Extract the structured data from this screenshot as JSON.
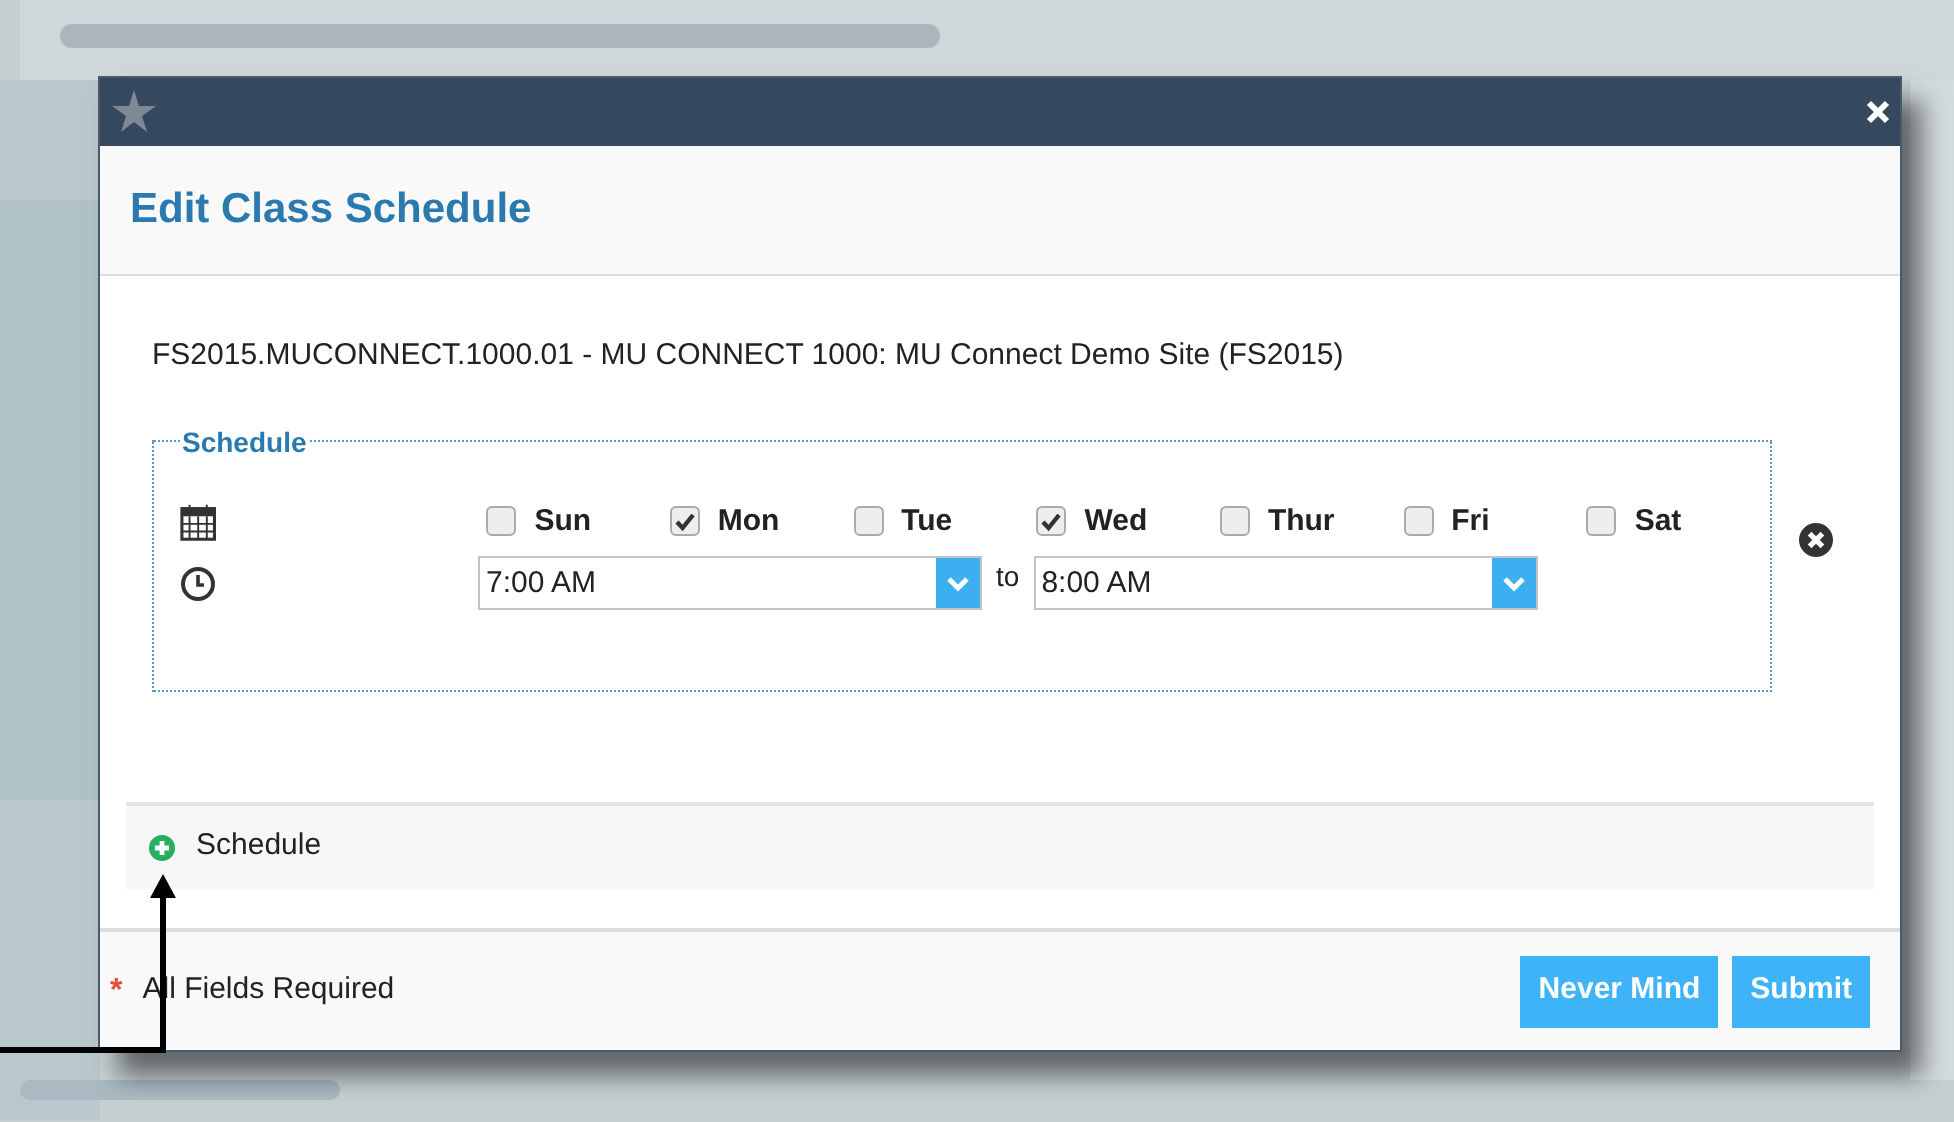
{
  "dialog": {
    "title": "Edit Class Schedule",
    "course": "FS2015.MUCONNECT.1000.01 - MU CONNECT 1000: MU Connect Demo Site (FS2015)"
  },
  "schedule": {
    "legend": "Schedule",
    "days": [
      {
        "label": "Sun",
        "checked": false
      },
      {
        "label": "Mon",
        "checked": true
      },
      {
        "label": "Tue",
        "checked": false
      },
      {
        "label": "Wed",
        "checked": true
      },
      {
        "label": "Thur",
        "checked": false
      },
      {
        "label": "Fri",
        "checked": false
      },
      {
        "label": "Sat",
        "checked": false
      }
    ],
    "start_time": "7:00 AM",
    "separator": "to",
    "end_time": "8:00 AM"
  },
  "add_schedule": {
    "label": "Schedule"
  },
  "footer": {
    "required_mark": "*",
    "required_note": "All Fields Required",
    "buttons": [
      "Never Mind",
      "Submit"
    ]
  }
}
